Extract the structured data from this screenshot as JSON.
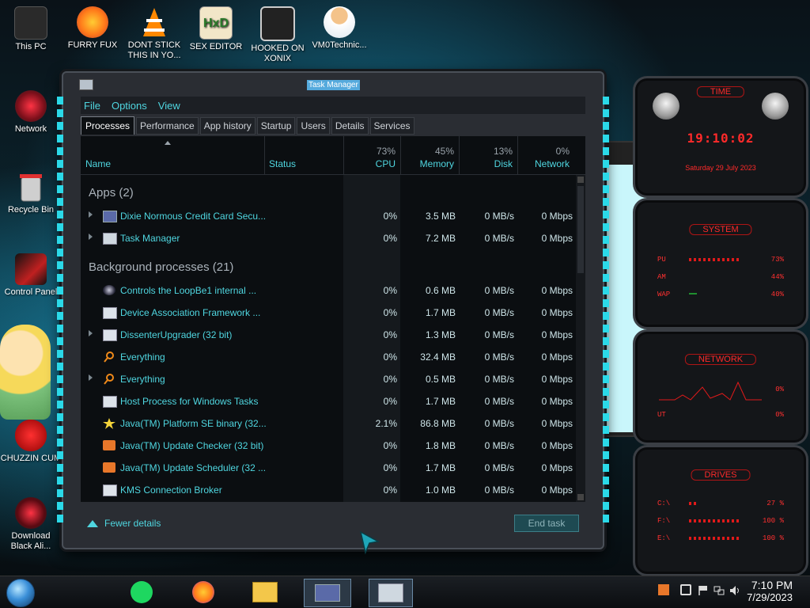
{
  "desktop": {
    "icons": [
      {
        "label": "This PC"
      },
      {
        "label": "FURRY FUX"
      },
      {
        "label": "DONT STICK THIS IN YO..."
      },
      {
        "label": "SEX EDITOR"
      },
      {
        "label": "HOOKED ON XONIX"
      },
      {
        "label": "VM0Technic..."
      },
      {
        "label": "Network"
      },
      {
        "label": "Recycle Bin"
      },
      {
        "label": "Control Panel"
      },
      {
        "label": "CHUZZIN CUM"
      },
      {
        "label": "Download Black Ali..."
      }
    ]
  },
  "task_manager": {
    "title": "Task Manager",
    "menu": [
      "File",
      "Options",
      "View"
    ],
    "tabs": [
      "Processes",
      "Performance",
      "App history",
      "Startup",
      "Users",
      "Details",
      "Services"
    ],
    "columns": {
      "name": "Name",
      "status": "Status",
      "cpu": {
        "pct": "73%",
        "label": "CPU"
      },
      "memory": {
        "pct": "45%",
        "label": "Memory"
      },
      "disk": {
        "pct": "13%",
        "label": "Disk"
      },
      "network": {
        "pct": "0%",
        "label": "Network"
      }
    },
    "groups": {
      "apps": "Apps (2)",
      "background": "Background processes (21)"
    },
    "apps": [
      {
        "name": "Dixie Normous Credit Card Secu...",
        "cpu": "0%",
        "memory": "3.5 MB",
        "disk": "0 MB/s",
        "network": "0 Mbps"
      },
      {
        "name": "Task Manager",
        "cpu": "0%",
        "memory": "7.2 MB",
        "disk": "0 MB/s",
        "network": "0 Mbps"
      }
    ],
    "background": [
      {
        "name": "Controls the LoopBe1 internal ...",
        "cpu": "0%",
        "memory": "0.6 MB",
        "disk": "0 MB/s",
        "network": "0 Mbps"
      },
      {
        "name": "Device Association Framework ...",
        "cpu": "0%",
        "memory": "1.7 MB",
        "disk": "0 MB/s",
        "network": "0 Mbps"
      },
      {
        "name": "DissenterUpgrader (32 bit)",
        "cpu": "0%",
        "memory": "1.3 MB",
        "disk": "0 MB/s",
        "network": "0 Mbps"
      },
      {
        "name": "Everything",
        "cpu": "0%",
        "memory": "32.4 MB",
        "disk": "0 MB/s",
        "network": "0 Mbps"
      },
      {
        "name": "Everything",
        "cpu": "0%",
        "memory": "0.5 MB",
        "disk": "0 MB/s",
        "network": "0 Mbps"
      },
      {
        "name": "Host Process for Windows Tasks",
        "cpu": "0%",
        "memory": "1.7 MB",
        "disk": "0 MB/s",
        "network": "0 Mbps"
      },
      {
        "name": "Java(TM) Platform SE binary (32...",
        "cpu": "2.1%",
        "memory": "86.8 MB",
        "disk": "0 MB/s",
        "network": "0 Mbps"
      },
      {
        "name": "Java(TM) Update Checker (32 bit)",
        "cpu": "0%",
        "memory": "1.8 MB",
        "disk": "0 MB/s",
        "network": "0 Mbps"
      },
      {
        "name": "Java(TM) Update Scheduler (32 ...",
        "cpu": "0%",
        "memory": "1.7 MB",
        "disk": "0 MB/s",
        "network": "0 Mbps"
      },
      {
        "name": "KMS Connection Broker",
        "cpu": "0%",
        "memory": "1.0 MB",
        "disk": "0 MB/s",
        "network": "0 Mbps"
      }
    ],
    "fewer_details": "Fewer details",
    "end_task": "End task"
  },
  "widgets": {
    "time": {
      "title": "TIME",
      "clock": "19:10:02",
      "date": "Saturday 29 July 2023"
    },
    "system": {
      "title": "SYSTEM",
      "rows": [
        {
          "label": "PU",
          "value": "73%"
        },
        {
          "label": "AM",
          "value": "44%"
        },
        {
          "label": "WAP",
          "value": "40%"
        }
      ]
    },
    "network": {
      "title": "NETWORK",
      "rows": [
        {
          "value": "0%"
        },
        {
          "label": "UT",
          "value": "0%"
        }
      ]
    },
    "drives": {
      "title": "DRIVES",
      "rows": [
        {
          "label": "C:\\",
          "value": "27 %"
        },
        {
          "label": "F:\\",
          "value": "100 %"
        },
        {
          "label": "E:\\",
          "value": "100 %"
        }
      ]
    }
  },
  "taskbar": {
    "time": "7:10 PM",
    "date": "7/29/2023"
  }
}
